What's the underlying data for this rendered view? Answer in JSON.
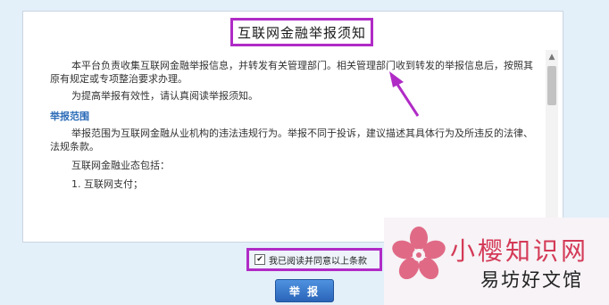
{
  "title": "互联网金融举报须知",
  "paragraphs": {
    "p1": "本平台负责收集互联网金融举报信息，并转发有关管理部门。相关管理部门收到转发的举报信息后，按照其原有规定或专项整治要求办理。",
    "p2": "为提高举报有效性，请认真阅读举报须知。"
  },
  "section": {
    "heading": "举报范围",
    "p1": "举报范围为互联网金融从业机构的违法违规行为。举报不同于投诉，建议描述其具体行为及所违反的法律、法规条款。",
    "p2": "互联网金融业态包括：",
    "item1": "1. 互联网支付；"
  },
  "agree": {
    "checked": true,
    "label": "我已阅读并同意以上条款"
  },
  "submit_label": "举 报",
  "watermark": {
    "top": "小樱知识网",
    "bottom": "易坊好文馆"
  },
  "colors": {
    "highlight": "#b02bc6",
    "heading": "#2b6cb8",
    "button": "#2a64b8",
    "watermark_red": "#d43a57"
  },
  "icons": {
    "scroll_up": "chevron-up-icon",
    "checkbox": "check-icon",
    "logo": "cherry-blossom-icon"
  }
}
